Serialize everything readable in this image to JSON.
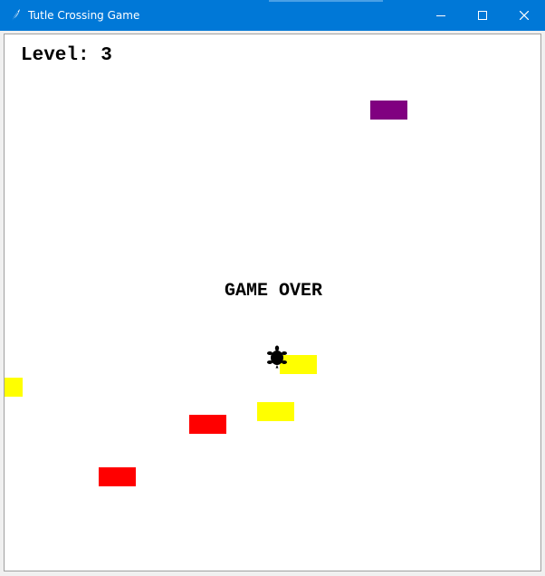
{
  "window": {
    "title": "Tutle Crossing Game",
    "icons": {
      "app": "feather-icon",
      "minimize": "minimize-icon",
      "maximize": "maximize-icon",
      "close": "close-icon"
    }
  },
  "game": {
    "level_text": "Level: 3",
    "status_text": "GAME OVER",
    "player": "turtle",
    "cars": [
      {
        "color": "#800080"
      },
      {
        "color": "#ffff00"
      },
      {
        "color": "#ffff00"
      },
      {
        "color": "#ffff00"
      },
      {
        "color": "#ff0000"
      },
      {
        "color": "#ff0000"
      }
    ]
  }
}
